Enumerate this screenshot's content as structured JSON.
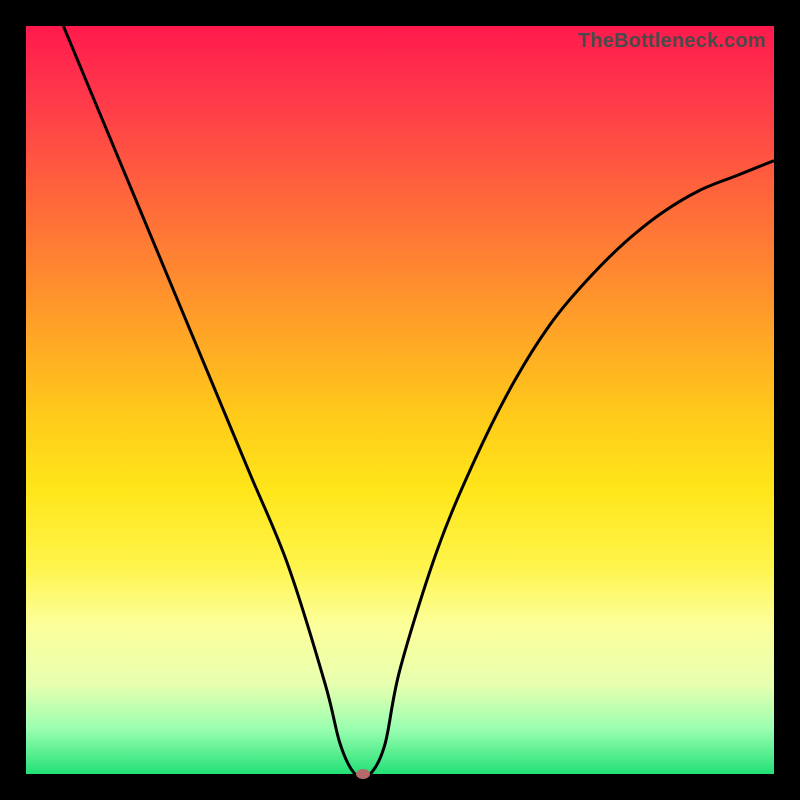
{
  "watermark": "TheBottleneck.com",
  "colors": {
    "frame": "#000000",
    "curve": "#000000",
    "marker": "#b46a6a"
  },
  "chart_data": {
    "type": "line",
    "title": "",
    "xlabel": "",
    "ylabel": "",
    "xlim": [
      0,
      100
    ],
    "ylim": [
      0,
      100
    ],
    "grid": false,
    "legend": false,
    "series": [
      {
        "name": "bottleneck-curve",
        "x": [
          5,
          10,
          15,
          20,
          25,
          30,
          35,
          40,
          42,
          44,
          46,
          48,
          50,
          55,
          60,
          65,
          70,
          75,
          80,
          85,
          90,
          95,
          100
        ],
        "y": [
          100,
          88,
          76,
          64,
          52,
          40,
          28,
          12,
          4,
          0,
          0,
          4,
          14,
          30,
          42,
          52,
          60,
          66,
          71,
          75,
          78,
          80,
          82
        ]
      }
    ],
    "marker": {
      "x": 45,
      "y": 0
    },
    "background_gradient": {
      "top": "#ff1a4d",
      "upper_mid": "#ff9a2a",
      "mid": "#ffe61a",
      "lower_mid": "#fcff9a",
      "bottom": "#22e076"
    }
  }
}
